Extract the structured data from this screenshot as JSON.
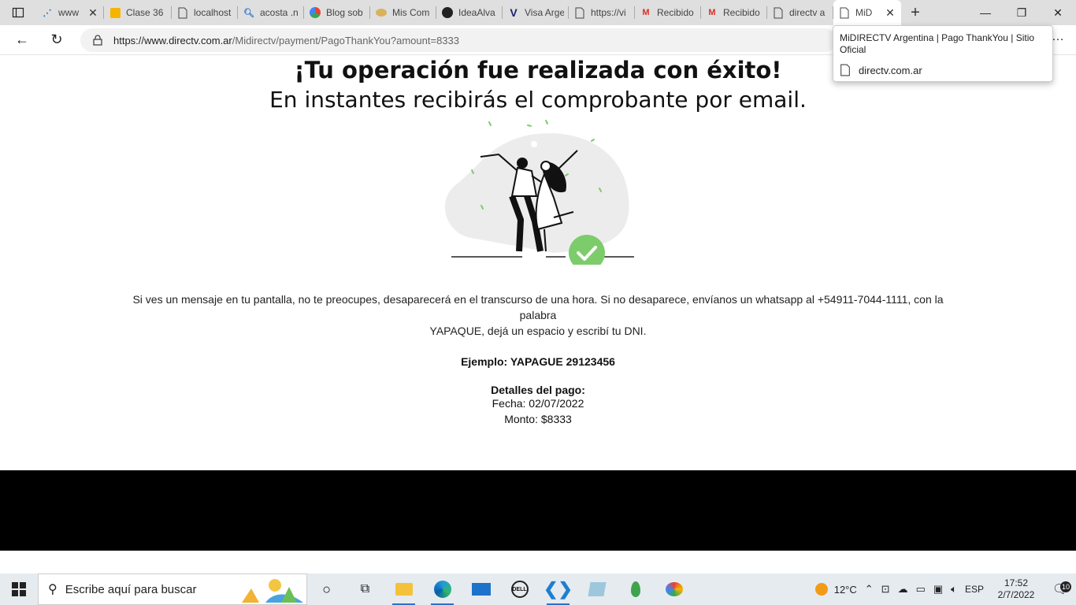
{
  "browser": {
    "tabs": [
      {
        "label": "www",
        "icon": "loading-icon"
      },
      {
        "label": "Clase 36",
        "icon": "slides-icon"
      },
      {
        "label": "localhost",
        "icon": "page-icon"
      },
      {
        "label": "acosta .n",
        "icon": "search-icon"
      },
      {
        "label": "Blog sob",
        "icon": "blog-icon"
      },
      {
        "label": "Mis Com",
        "icon": "food-icon"
      },
      {
        "label": "IdeaAlva",
        "icon": "github-icon"
      },
      {
        "label": "Visa Arge",
        "icon": "visa-icon"
      },
      {
        "label": "https://vi",
        "icon": "page-icon"
      },
      {
        "label": "Recibido",
        "icon": "gmail-icon"
      },
      {
        "label": "Recibido",
        "icon": "gmail-icon"
      },
      {
        "label": "directv a",
        "icon": "page-icon"
      },
      {
        "label": "MiD",
        "icon": "page-icon",
        "active": true
      }
    ],
    "url_host": "https://www.directv.com.ar",
    "url_path": "/Midirectv/payment/PagoThankYou?amount=8333",
    "tooltip": {
      "title": "MiDIRECTV Argentina | Pago ThankYou | Sitio Oficial",
      "domain": "directv.com.ar"
    }
  },
  "page": {
    "heading": "¡Tu operación fue realizada con éxito!",
    "subheading": "En instantes recibirás el comprobante por email.",
    "message_line1": "Si ves un mensaje en tu pantalla, no te preocupes, desaparecerá en el transcurso de una hora. Si no desaparece, envíanos un whatsapp al +54911-7044-1111, con la palabra",
    "message_line2": "YAPAQUE, dejá un espacio y escribí tu DNI.",
    "example": "Ejemplo: YAPAGUE 29123456",
    "details_title": "Detalles del pago:",
    "date_line": "Fecha: 02/07/2022",
    "amount_line": "Monto: $8333",
    "accent_color": "#7ccc6c"
  },
  "taskbar": {
    "search_placeholder": "Escribe aquí para buscar",
    "temperature": "12°C",
    "language": "ESP",
    "time": "17:52",
    "date": "2/7/2022",
    "notifications": "10"
  }
}
